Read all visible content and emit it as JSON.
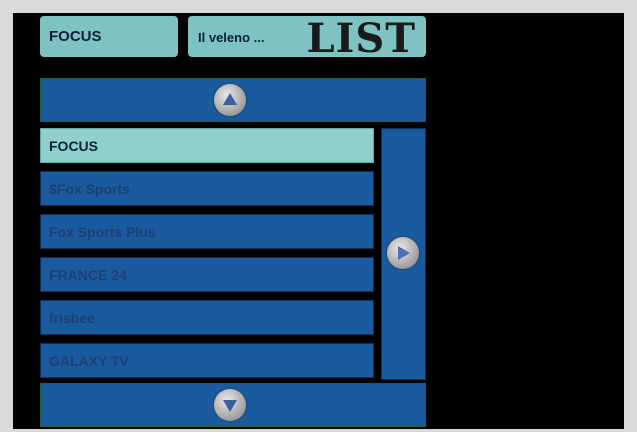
{
  "header": {
    "channel": "FOCUS",
    "program": "Il veleno ...",
    "mode_label": "LIST"
  },
  "channels": [
    {
      "name": "FOCUS",
      "selected": true
    },
    {
      "name": "$Fox Sports",
      "selected": false
    },
    {
      "name": "Fox Sports Plus",
      "selected": false
    },
    {
      "name": "FRANCE 24",
      "selected": false
    },
    {
      "name": "frisbee",
      "selected": false
    },
    {
      "name": "GALAXY TV",
      "selected": false
    }
  ],
  "icons": {
    "scroll_up": "arrow-up-icon",
    "scroll_down": "arrow-down-icon",
    "page_right": "arrow-right-icon"
  },
  "colors": {
    "row_bg": "#1a5a9e",
    "selected_bg": "#8fd0cc",
    "header_bg": "#7ec3c2"
  }
}
